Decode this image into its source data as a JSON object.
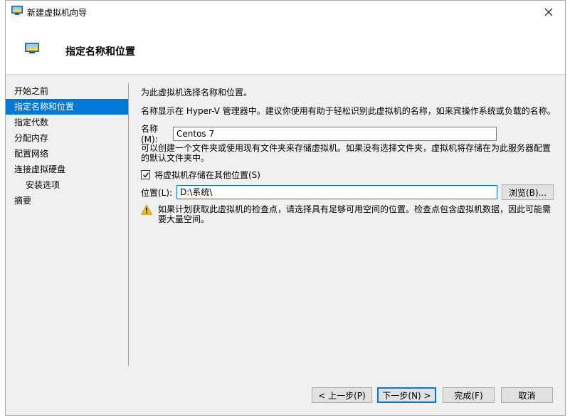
{
  "window": {
    "title": "新建虚拟机向导",
    "page_title": "指定名称和位置"
  },
  "nav": {
    "items": [
      {
        "label": "开始之前",
        "active": false,
        "sub": false
      },
      {
        "label": "指定名称和位置",
        "active": true,
        "sub": false
      },
      {
        "label": "指定代数",
        "active": false,
        "sub": false
      },
      {
        "label": "分配内存",
        "active": false,
        "sub": false
      },
      {
        "label": "配置网络",
        "active": false,
        "sub": false
      },
      {
        "label": "连接虚拟硬盘",
        "active": false,
        "sub": false
      },
      {
        "label": "安装选项",
        "active": false,
        "sub": true
      },
      {
        "label": "摘要",
        "active": false,
        "sub": false
      }
    ]
  },
  "content": {
    "intro": "为此虚拟机选择名称和位置。",
    "name_hint": "名称显示在 Hyper-V 管理器中。建议你使用有助于轻松识别此虚拟机的名称，如来宾操作系统或负载的名称。",
    "name_label": "名称(M):",
    "name_value": "Centos 7",
    "folder_hint": "可以创建一个文件夹或使用现有文件夹来存储虚拟机。如果没有选择文件夹，虚拟机将存储在为此服务器配置的默认文件夹中。",
    "store_checkbox_label": "将虚拟机存储在其他位置(S)",
    "store_checked": true,
    "location_label": "位置(L):",
    "location_value": "D:\\系统\\",
    "browse_label": "浏览(B)...",
    "warning_text": "如果计划获取此虚拟机的检查点，请选择具有足够可用空间的位置。检查点包含虚拟机数据，因此可能需要大量空间。"
  },
  "footer": {
    "prev_label": "< 上一步(P)",
    "next_label": "下一步(N) >",
    "finish_label": "完成(F)",
    "cancel_label": "取消"
  },
  "colors": {
    "accent": "#0078d7",
    "warning": "#f5c211"
  }
}
